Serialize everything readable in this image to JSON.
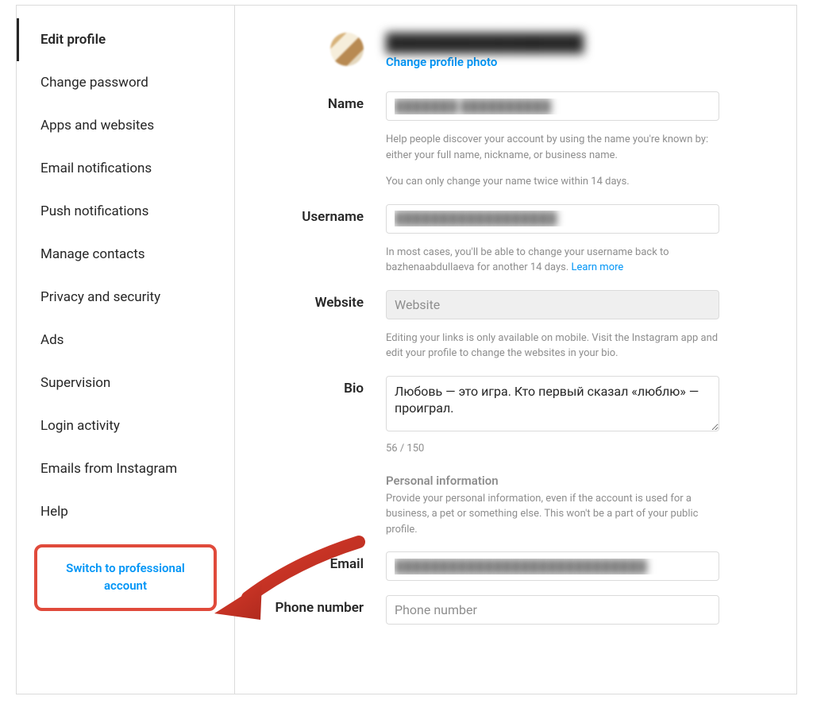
{
  "colors": {
    "accent": "#0095f6",
    "highlight_border": "#e04a3b",
    "text_muted": "#8e8e8e",
    "border": "#dbdbdb"
  },
  "sidebar": {
    "items": [
      {
        "label": "Edit profile",
        "active": true
      },
      {
        "label": "Change password"
      },
      {
        "label": "Apps and websites"
      },
      {
        "label": "Email notifications"
      },
      {
        "label": "Push notifications"
      },
      {
        "label": "Manage contacts"
      },
      {
        "label": "Privacy and security"
      },
      {
        "label": "Ads"
      },
      {
        "label": "Supervision"
      },
      {
        "label": "Login activity"
      },
      {
        "label": "Emails from Instagram"
      },
      {
        "label": "Help"
      }
    ],
    "switch_account_label": "Switch to professional account"
  },
  "header": {
    "username_display": "████████████████",
    "change_photo_label": "Change profile photo"
  },
  "fields": {
    "name": {
      "label": "Name",
      "value": "███████ ██████████",
      "help1": "Help people discover your account by using the name you're known by: either your full name, nickname, or business name.",
      "help2": "You can only change your name twice within 14 days."
    },
    "username": {
      "label": "Username",
      "value": "██████████████████",
      "help": "In most cases, you'll be able to change your username back to bazhenaabdullaeva for another 14 days. ",
      "learn_more": "Learn more"
    },
    "website": {
      "label": "Website",
      "placeholder": "Website",
      "help": "Editing your links is only available on mobile. Visit the Instagram app and edit your profile to change the websites in your bio."
    },
    "bio": {
      "label": "Bio",
      "value": "Любовь — это игра. Кто первый сказал «люблю» — проиграл.",
      "char_count": "56 / 150"
    },
    "personal_info": {
      "header": "Personal information",
      "help": "Provide your personal information, even if the account is used for a business, a pet or something else. This won't be a part of your public profile."
    },
    "email": {
      "label": "Email",
      "value": "████████████████████████████"
    },
    "phone": {
      "label": "Phone number",
      "placeholder": "Phone number"
    }
  }
}
